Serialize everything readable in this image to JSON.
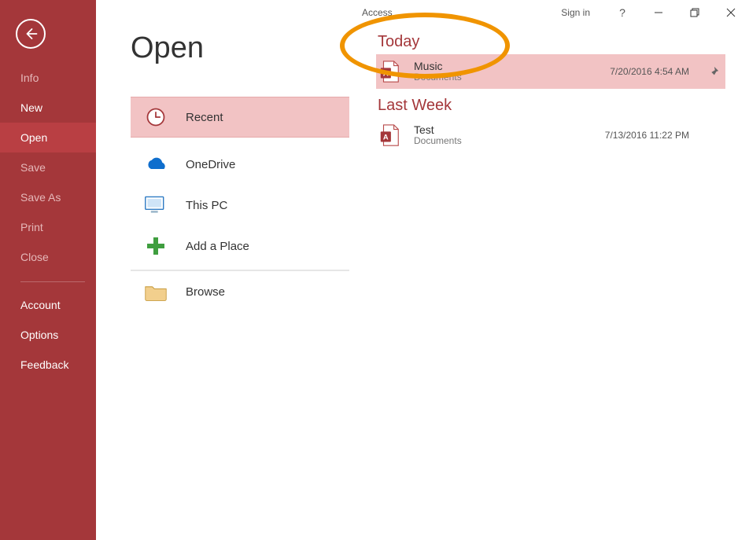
{
  "titlebar": {
    "apptitle": "Access",
    "signin": "Sign in"
  },
  "sidebar": {
    "items": [
      {
        "label": "Info"
      },
      {
        "label": "New"
      },
      {
        "label": "Open"
      },
      {
        "label": "Save"
      },
      {
        "label": "Save As"
      },
      {
        "label": "Print"
      },
      {
        "label": "Close"
      }
    ],
    "footer": [
      {
        "label": "Account"
      },
      {
        "label": "Options"
      },
      {
        "label": "Feedback"
      }
    ]
  },
  "page_heading": "Open",
  "locations": [
    {
      "label": "Recent"
    },
    {
      "label": "OneDrive"
    },
    {
      "label": "This PC"
    },
    {
      "label": "Add a Place"
    },
    {
      "label": "Browse"
    }
  ],
  "groups": [
    {
      "title": "Today",
      "files": [
        {
          "name": "Music",
          "path": "Documents",
          "date": "7/20/2016 4:54 AM"
        }
      ]
    },
    {
      "title": "Last Week",
      "files": [
        {
          "name": "Test",
          "path": "Documents",
          "date": "7/13/2016 11:22 PM"
        }
      ]
    }
  ]
}
